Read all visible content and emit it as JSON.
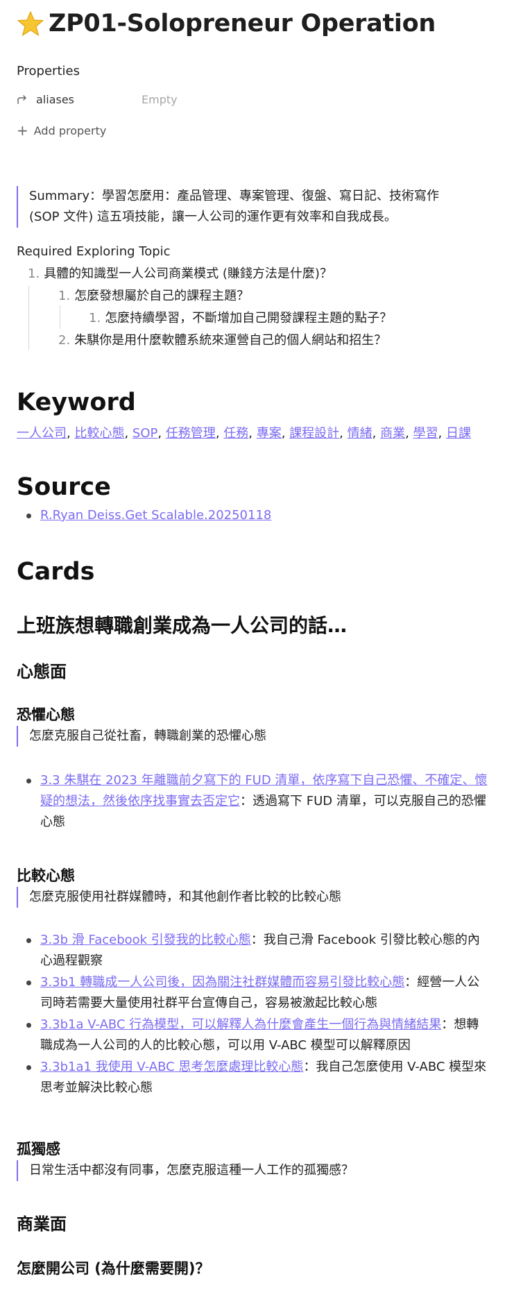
{
  "page": {
    "title": "ZP01-Solopreneur Operation",
    "title_icon": "star-icon"
  },
  "properties": {
    "heading": "Properties",
    "aliases_key": "aliases",
    "aliases_value": "Empty",
    "add_label": "Add property"
  },
  "summary": "Summary：學習怎麼用：產品管理、專案管理、復盤、寫日記、技術寫作 (SOP 文件) 這五項技能，讓一人公司的運作更有效率和自我成長。",
  "exploring": {
    "heading": "Required Exploring Topic",
    "items": [
      {
        "num": "1.",
        "text": "具體的知識型一人公司商業模式 (賺錢方法是什麼)？"
      },
      {
        "num": "1.",
        "text": "怎麼發想屬於自己的課程主題？"
      },
      {
        "num": "1.",
        "text": "怎麼持續學習，不斷增加自己開發課程主題的點子？"
      },
      {
        "num": "2.",
        "text": "朱騏你是用什麼軟體系統來運營自己的個人網站和招生？"
      }
    ]
  },
  "keyword": {
    "heading": "Keyword",
    "tags": [
      "一人公司",
      "比較心態",
      "SOP",
      "任務管理",
      "任務",
      "專案",
      "課程設計",
      "情緒",
      "商業",
      "學習",
      "日課"
    ],
    "separator": ", "
  },
  "source": {
    "heading": "Source",
    "items": [
      "R.Ryan Deiss.Get Scalable.20250118"
    ]
  },
  "cards": {
    "heading": "Cards",
    "subheading": "上班族想轉職創業成為一人公司的話…",
    "mindset": {
      "heading": "心態面",
      "fear": {
        "heading": "恐懼心態",
        "quote": "怎麼克服自己從社畜，轉職創業的恐懼心態",
        "bullets": [
          {
            "link": "3.3 朱騏在 2023 年離職前夕寫下的 FUD 清單，依序寫下自己恐懼、不確定、懷疑的想法，然後依序找事實去否定它",
            "text": "：透過寫下 FUD 清單，可以克服自己的恐懼心態"
          }
        ]
      },
      "compare": {
        "heading": "比較心態",
        "quote": "怎麼克服使用社群媒體時，和其他創作者比較的比較心態",
        "bullets": [
          {
            "link": "3.3b 滑 Facebook 引發我的比較心態",
            "text": "：我自己滑 Facebook 引發比較心態的內心過程觀察"
          },
          {
            "link": "3.3b1 轉職成一人公司後，因為關注社群媒體而容易引發比較心態",
            "text": "：經營一人公司時若需要大量使用社群平台宣傳自己，容易被激起比較心態"
          },
          {
            "link": "3.3b1a V-ABC 行為模型，可以解釋人為什麼會產生一個行為與情緒結果",
            "text": "：想轉職成為一人公司的人的比較心態，可以用 V-ABC 模型可以解釋原因"
          },
          {
            "link": "3.3b1a1 我使用 V-ABC 思考怎麼處理比較心態",
            "text": "：我自己怎麼使用 V-ABC 模型來思考並解決比較心態"
          }
        ]
      },
      "lonely": {
        "heading": "孤獨感",
        "quote": "日常生活中都沒有同事，怎麼克服這種一人工作的孤獨感？"
      }
    },
    "business": {
      "heading": "商業面",
      "sub": "怎麼開公司 (為什麼需要開)？"
    }
  }
}
